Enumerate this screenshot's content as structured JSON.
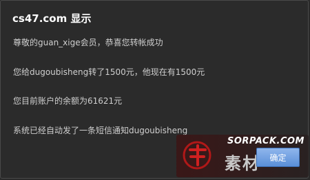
{
  "dialog": {
    "title": "cs47.com 显示",
    "lines": [
      "尊敬的guan_xige会员，恭喜您转帐成功",
      "您给dugoubisheng转了1500元，他现在有1500元",
      "您目前账户的余额为61621元",
      "系统已经自动发了一条短信通知dugoubisheng"
    ],
    "ok_label": "确定"
  },
  "watermark": {
    "site": "SORPACK.COM",
    "cn_text": "素材"
  },
  "colors": {
    "dialog_bg": "#2b2b2b",
    "button_blue": "#5a8fd8"
  }
}
